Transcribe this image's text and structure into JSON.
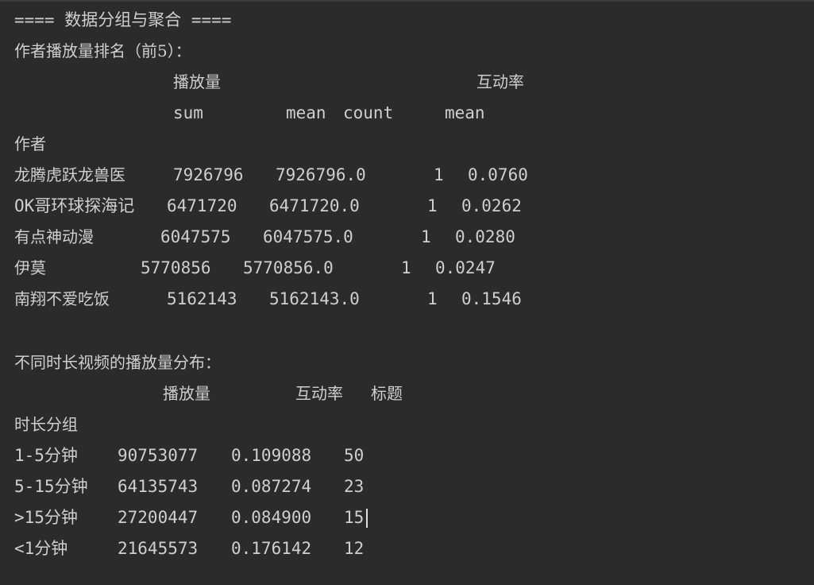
{
  "heading": "==== 数据分组与聚合 ====",
  "author_section": {
    "title": "作者播放量排名（前5）：",
    "group_headers": [
      "播放量",
      "互动率"
    ],
    "sub_headers": [
      "sum",
      "mean",
      "count",
      "mean"
    ],
    "index_name": "作者",
    "rows": [
      {
        "name": "龙腾虎跃龙兽医",
        "sum": "7926796",
        "mean": "7926796.0",
        "count": "1",
        "rate": "0.0760"
      },
      {
        "name": "OK哥环球探海记",
        "sum": "6471720",
        "mean": "6471720.0",
        "count": "1",
        "rate": "0.0262"
      },
      {
        "name": "有点神动漫",
        "sum": "6047575",
        "mean": "6047575.0",
        "count": "1",
        "rate": "0.0280"
      },
      {
        "name": "伊莫",
        "sum": "5770856",
        "mean": "5770856.0",
        "count": "1",
        "rate": "0.0247"
      },
      {
        "name": "南翔不爱吃饭",
        "sum": "5162143",
        "mean": "5162143.0",
        "count": "1",
        "rate": "0.1546"
      }
    ]
  },
  "duration_section": {
    "title": "不同时长视频的播放量分布：",
    "headers": [
      "播放量",
      "互动率",
      "标题"
    ],
    "index_name": "时长分组",
    "rows": [
      {
        "group": "1-5分钟",
        "plays": "90753077",
        "rate": "0.109088",
        "count": "50"
      },
      {
        "group": "5-15分钟",
        "plays": "64135743",
        "rate": "0.087274",
        "count": "23"
      },
      {
        "group": ">15分钟",
        "plays": "27200447",
        "rate": "0.084900",
        "count": "15"
      },
      {
        "group": "<1分钟",
        "plays": "21645573",
        "rate": "0.176142",
        "count": "12"
      }
    ]
  }
}
